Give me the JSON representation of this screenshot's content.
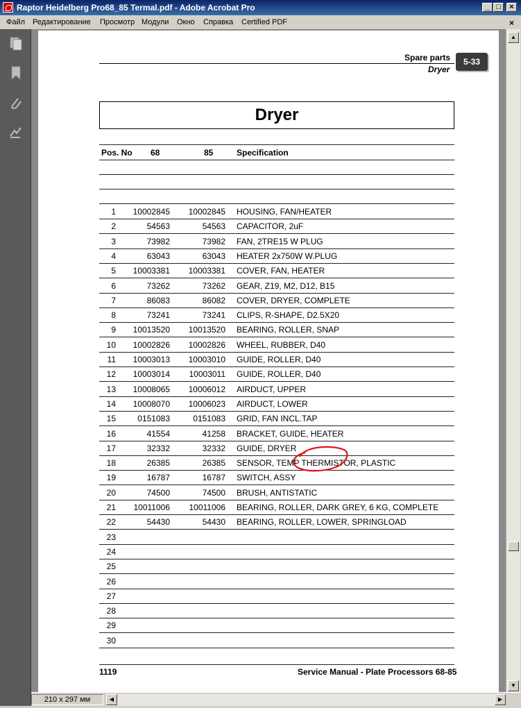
{
  "window": {
    "title": "Raptor Heidelberg Pro68_85 Termal.pdf - Adobe Acrobat Pro",
    "menu": [
      "Файл",
      "Редактирование",
      "Просмотр",
      "Модули",
      "Окно",
      "Справка",
      "Certified PDF"
    ],
    "page_size": "210 x 297 мм"
  },
  "page": {
    "header_section": "Spare parts",
    "header_subsection": "Dryer",
    "tab_label": "5-33",
    "title": "Dryer",
    "columns": [
      "Pos. No",
      "68",
      "85",
      "Specification"
    ],
    "rows": [
      {
        "pos": "1",
        "p68": "10002845",
        "p85": "10002845",
        "spec": "HOUSING, FAN/HEATER"
      },
      {
        "pos": "2",
        "p68": "54563",
        "p85": "54563",
        "spec": "CAPACITOR, 2uF"
      },
      {
        "pos": "3",
        "p68": "73982",
        "p85": "73982",
        "spec": "FAN, 2TRE15 W PLUG"
      },
      {
        "pos": "4",
        "p68": "63043",
        "p85": "63043",
        "spec": "HEATER 2x750W W.PLUG"
      },
      {
        "pos": "5",
        "p68": "10003381",
        "p85": "10003381",
        "spec": "COVER, FAN, HEATER"
      },
      {
        "pos": "6",
        "p68": "73262",
        "p85": "73262",
        "spec": "GEAR, Z19, M2, D12, B15"
      },
      {
        "pos": "7",
        "p68": "86083",
        "p85": "86082",
        "spec": "COVER, DRYER, COMPLETE"
      },
      {
        "pos": "8",
        "p68": "73241",
        "p85": "73241",
        "spec": "CLIPS, R-SHAPE, D2.5X20"
      },
      {
        "pos": "9",
        "p68": "10013520",
        "p85": "10013520",
        "spec": "BEARING, ROLLER, SNAP"
      },
      {
        "pos": "10",
        "p68": "10002826",
        "p85": "10002826",
        "spec": "WHEEL, RUBBER, D40"
      },
      {
        "pos": "11",
        "p68": "10003013",
        "p85": "10003010",
        "spec": "GUIDE, ROLLER, D40"
      },
      {
        "pos": "12",
        "p68": "10003014",
        "p85": "10003011",
        "spec": "GUIDE, ROLLER, D40"
      },
      {
        "pos": "13",
        "p68": "10008065",
        "p85": "10006012",
        "spec": "AIRDUCT, UPPER"
      },
      {
        "pos": "14",
        "p68": "10008070",
        "p85": "10006023",
        "spec": "AIRDUCT, LOWER"
      },
      {
        "pos": "15",
        "p68": "0151083",
        "p85": "0151083",
        "spec": "GRID, FAN INCL.TAP"
      },
      {
        "pos": "16",
        "p68": "41554",
        "p85": "41258",
        "spec": "BRACKET, GUIDE, HEATER"
      },
      {
        "pos": "17",
        "p68": "32332",
        "p85": "32332",
        "spec": "GUIDE, DRYER"
      },
      {
        "pos": "18",
        "p68": "26385",
        "p85": "26385",
        "spec": "SENSOR, TEMP THERMISTOR, PLASTIC"
      },
      {
        "pos": "19",
        "p68": "16787",
        "p85": "16787",
        "spec": "SWITCH, ASSY"
      },
      {
        "pos": "20",
        "p68": "74500",
        "p85": "74500",
        "spec": "BRUSH, ANTISTATIC"
      },
      {
        "pos": "21",
        "p68": "10011006",
        "p85": "10011006",
        "spec": "BEARING, ROLLER, DARK GREY, 6 KG, COMPLETE"
      },
      {
        "pos": "22",
        "p68": "54430",
        "p85": "54430",
        "spec": "BEARING, ROLLER, LOWER, SPRINGLOAD"
      },
      {
        "pos": "23",
        "p68": "",
        "p85": "",
        "spec": ""
      },
      {
        "pos": "24",
        "p68": "",
        "p85": "",
        "spec": ""
      },
      {
        "pos": "25",
        "p68": "",
        "p85": "",
        "spec": ""
      },
      {
        "pos": "26",
        "p68": "",
        "p85": "",
        "spec": ""
      },
      {
        "pos": "27",
        "p68": "",
        "p85": "",
        "spec": ""
      },
      {
        "pos": "28",
        "p68": "",
        "p85": "",
        "spec": ""
      },
      {
        "pos": "29",
        "p68": "",
        "p85": "",
        "spec": ""
      },
      {
        "pos": "30",
        "p68": "",
        "p85": "",
        "spec": ""
      }
    ],
    "footer_page": "1119",
    "footer_title": "Service Manual - Plate Processors 68-85",
    "annotation_color": "#e0161c"
  }
}
